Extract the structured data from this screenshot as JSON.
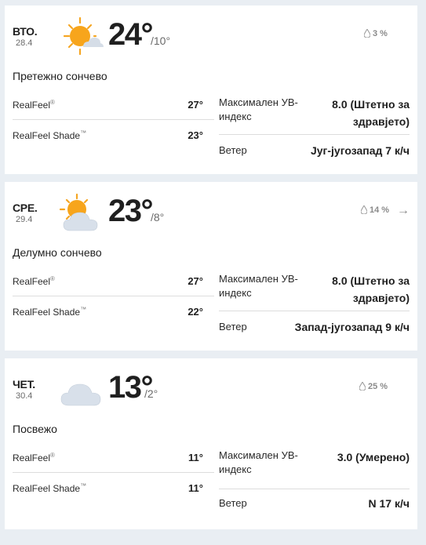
{
  "days": [
    {
      "day": "ВТО.",
      "date": "28.4",
      "temp": "24°",
      "low": "/10°",
      "precip": "3 %",
      "phrase": "Претежно сончево",
      "realfeel_label": "RealFeel",
      "realfeel": "27°",
      "realfeel_shade_label": "RealFeel Shade",
      "realfeel_shade": "23°",
      "uv_label": "Максимален УВ-индекс",
      "uv_value": "8.0 (Штетно за здравјето)",
      "wind_label": "Ветер",
      "wind": "Југ-југозапад 7 к/ч",
      "icon": "mostly-sunny-icon",
      "has_arrow": false
    },
    {
      "day": "СРЕ.",
      "date": "29.4",
      "temp": "23°",
      "low": "/8°",
      "precip": "14 %",
      "phrase": "Делумно сончево",
      "realfeel_label": "RealFeel",
      "realfeel": "27°",
      "realfeel_shade_label": "RealFeel Shade",
      "realfeel_shade": "22°",
      "uv_label": "Максимален УВ-индекс",
      "uv_value": "8.0 (Штетно за здравјето)",
      "wind_label": "Ветер",
      "wind": "Запад-југозапад 9 к/ч",
      "icon": "partly-sunny-icon",
      "has_arrow": true
    },
    {
      "day": "ЧЕТ.",
      "date": "30.4",
      "temp": "13°",
      "low": "/2°",
      "precip": "25 %",
      "phrase": "Посвежо",
      "realfeel_label": "RealFeel",
      "realfeel": "11°",
      "realfeel_shade_label": "RealFeel Shade",
      "realfeel_shade": "11°",
      "uv_label": "Максимален УВ-индекс",
      "uv_value": "3.0 (Умерено)",
      "wind_label": "Ветер",
      "wind": "N 17 к/ч",
      "icon": "cloudy-icon",
      "has_arrow": false
    }
  ],
  "colors": {
    "sun": "#f5a623",
    "cloud": "#cfd8e3",
    "background": "#e9eef3"
  }
}
